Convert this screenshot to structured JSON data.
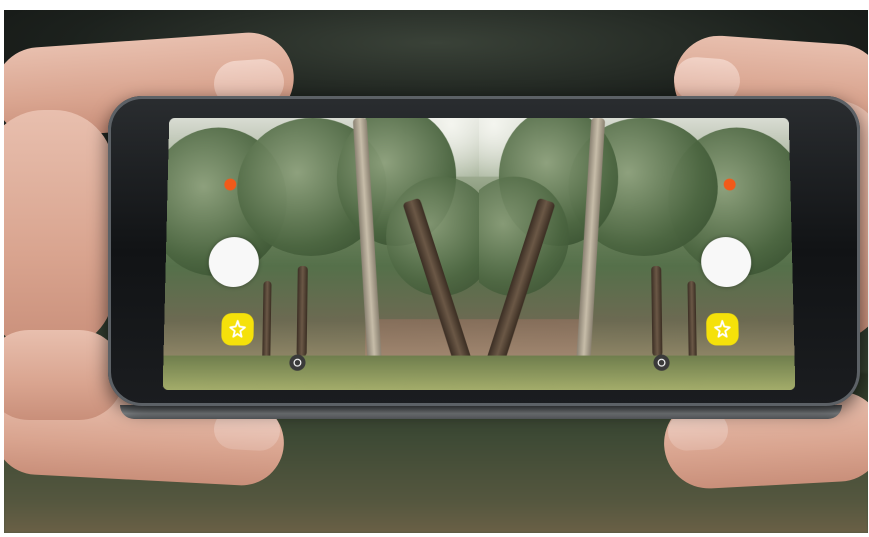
{
  "scene": {
    "subject": "hands-holding-phone",
    "screen_view": "mirrored-split-camera"
  },
  "colors": {
    "record_indicator": "#f25a1a",
    "shutter": "#f8f8f8",
    "effect_button": "#f5e10a",
    "sync_icon": "#3a3a3a"
  },
  "icons": {
    "effect": "sparkle-icon",
    "sync": "sync-icon",
    "record": "record-dot-icon",
    "shutter": "shutter-button"
  }
}
